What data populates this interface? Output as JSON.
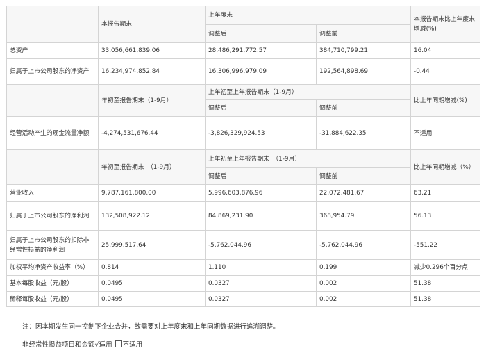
{
  "sec1": {
    "h_this": "本报告期末",
    "h_last": "上年度末",
    "h_change": "本报告期末比上年度末增减(%)",
    "h_adj_after": "调整后",
    "h_adj_before": "调整前",
    "rows": [
      {
        "label": "总资产",
        "v1": "33,056,661,839.06",
        "v2": "28,486,291,772.57",
        "v3": "384,710,799.21",
        "v4": "16.04"
      },
      {
        "label": "归属于上市公司股东的净资产",
        "v1": "16,234,974,852.84",
        "v2": "16,306,996,979.09",
        "v3": "192,564,898.69",
        "v4": "-0.44"
      }
    ]
  },
  "sec2": {
    "h_this": "年初至报告期末（1-9月）",
    "h_last": "上年初至上年报告期末（1-9月）",
    "h_change": "比上年同期增减(%)",
    "h_adj_after": "调整后",
    "h_adj_before": "调整前",
    "rows": [
      {
        "label": "经营活动产生的现金流量净额",
        "v1": "-4,274,531,676.44",
        "v2": "-3,826,329,924.53",
        "v3": "-31,884,622.35",
        "v4": "不适用"
      }
    ]
  },
  "sec3": {
    "h_this": "年初至报告期末　（1-9月）",
    "h_last": "上年初至上年报告期末　（1-9月）",
    "h_change": "比上年同期增减（%）",
    "h_adj_after": "调整后",
    "h_adj_before": "调整前",
    "rows": [
      {
        "label": "营业收入",
        "v1": "9,787,161,800.00",
        "v2": "5,996,603,876.96",
        "v3": "22,072,481.67",
        "v4": "63.21"
      },
      {
        "label": "归属于上市公司股东的净利润",
        "v1": "132,508,922.12",
        "v2": "84,869,231.90",
        "v3": "368,954.79",
        "v4": "56.13"
      },
      {
        "label": "归属于上市公司股东的扣除非经常性损益的净利润",
        "v1": "25,999,517.64",
        "v2": "-5,762,044.96",
        "v3": "-5,762,044.96",
        "v4": "-551.22"
      },
      {
        "label": "加权平均净资产收益率（%）",
        "v1": "0.814",
        "v2": "1.110",
        "v3": "0.199",
        "v4": "减少0.296个百分点"
      },
      {
        "label": "基本每股收益（元/股）",
        "v1": "0.0495",
        "v2": "0.0327",
        "v3": "0.002",
        "v4": "51.38"
      },
      {
        "label": "稀释每股收益（元/股）",
        "v1": "0.0495",
        "v2": "0.0327",
        "v3": "0.002",
        "v4": "51.38"
      }
    ]
  },
  "note": "注：因本期发生同一控制下企业合并，故需要对上年度末和上年同期数据进行追溯调整。",
  "nonrecurring": {
    "prefix": "非经常性损益项目和金额",
    "opt_yes": "√适用",
    "opt_no": "不适用"
  }
}
